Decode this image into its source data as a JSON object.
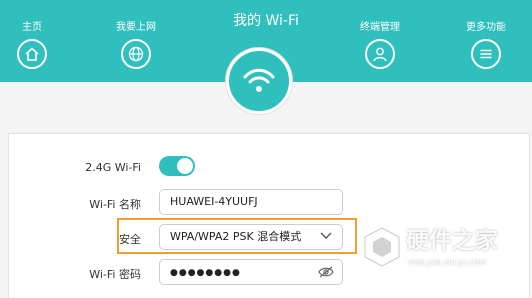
{
  "header": {
    "title": "我的 Wi-Fi",
    "nav": [
      {
        "label": "主页",
        "icon": "home-icon"
      },
      {
        "label": "我要上网",
        "icon": "globe-icon"
      },
      {
        "label": "终端管理",
        "icon": "user-icon"
      },
      {
        "label": "更多功能",
        "icon": "menu-icon"
      }
    ],
    "accent_color": "#2fbfbd"
  },
  "form": {
    "wifi_24g_label": "2.4G Wi-Fi",
    "wifi_24g_enabled": true,
    "name_label": "Wi-Fi 名称",
    "name_value": "HUAWEI-4YUUFJ",
    "security_label": "安全",
    "security_value": "WPA/WPA2 PSK 混合模式",
    "password_label": "Wi-Fi 密码",
    "password_value": "●●●●●●●●"
  },
  "highlight_color": "#f0a030",
  "watermark": {
    "text": "硬件之家",
    "sub": "YING JIAN ZHI JIA.COM"
  }
}
